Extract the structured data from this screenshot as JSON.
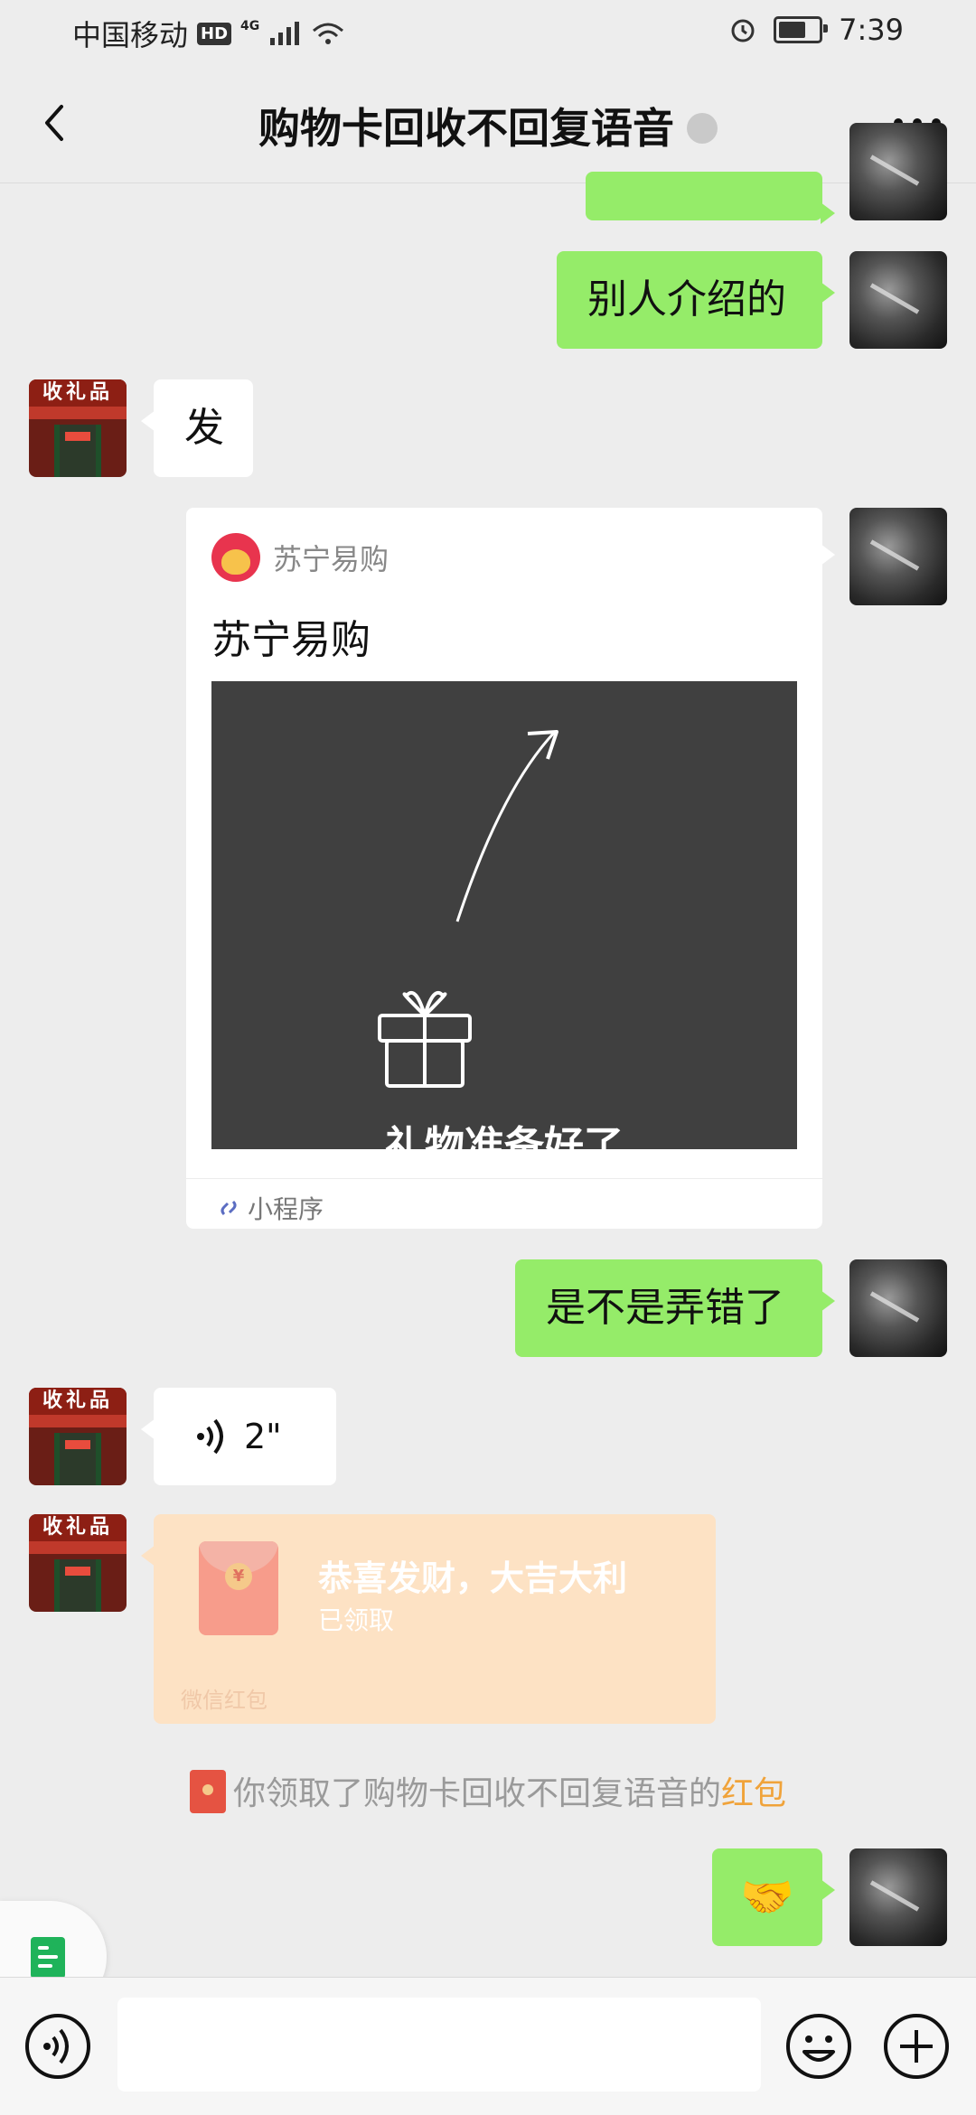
{
  "status_bar": {
    "carrier": "中国移动",
    "hd": "HD",
    "network": "4G",
    "time": "7:39"
  },
  "nav": {
    "title": "购物卡回收不回复语音"
  },
  "messages": {
    "m1_text": "别人介绍的",
    "m2_text": "发",
    "m5_text": "是不是弄错了",
    "m6_voice_duration": "2\"",
    "m8_emoji": "🤝"
  },
  "mini_program": {
    "source": "苏宁易购",
    "title": "苏宁易购",
    "image_text": "礼物准备好了",
    "footer": "小程序"
  },
  "red_packet": {
    "title": "恭喜发财，大吉大利",
    "status": "已领取",
    "footer": "微信红包"
  },
  "notice": {
    "prefix": "你领取了购物卡回收不回复语音的",
    "link": "红包"
  },
  "avatars": {
    "shop_sign": "收礼品"
  },
  "input": {
    "placeholder": ""
  },
  "colors": {
    "bubble_green": "#95ec69",
    "background": "#ededed",
    "red_packet_bg": "#fde2c4",
    "link_orange": "#f0a33a"
  }
}
